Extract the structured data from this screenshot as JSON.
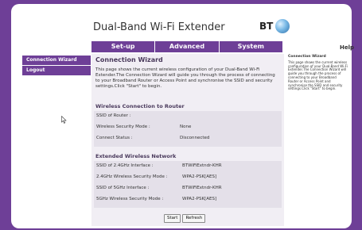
{
  "app_title": "Dual-Band Wi-Fi Extender",
  "logo_text": "BT",
  "nav_tabs": [
    "Set-up",
    "Advanced",
    "System"
  ],
  "help_link": "Help",
  "sidebar_items": [
    "Connection Wizard",
    "Logout"
  ],
  "main": {
    "title": "Connection Wizard",
    "intro": "This page shows the current wireless configuration of your Dual-Band Wi-Fi Extender.The Connection Wizard will guide you through the process of connecting to your Broadband Router or Access Point and synchronise the SSID and security settings.Click \"Start\" to begin."
  },
  "wireless_section": {
    "title": "Wireless Connection to Router",
    "rows": [
      {
        "label": "SSID of Router :",
        "value": ""
      },
      {
        "label": "Wireless Security Mode :",
        "value": "None"
      },
      {
        "label": "Connect Status :",
        "value": "Disconnected"
      }
    ]
  },
  "extended_section": {
    "title": "Extended Wireless Network",
    "rows": [
      {
        "label": "SSID of 2.4GHz Interface :",
        "value": "BTWiFiExtndr-KHR"
      },
      {
        "label": "2.4GHz Wireless Security Mode :",
        "value": "WPA2-PSK[AES]"
      },
      {
        "label": "SSID of 5GHz Interface :",
        "value": "BTWiFiExtndr-KHR"
      },
      {
        "label": "5GHz Wireless Security Mode :",
        "value": "WPA2-PSK[AES]"
      }
    ]
  },
  "buttons": {
    "start": "Start",
    "refresh": "Refresh"
  },
  "help_panel": {
    "title": "Connection Wizard",
    "text": "This page shows the current wireless configuration of your Dual-Band Wi-Fi Extender.The Connection Wizard will guide you through the process of connecting to your Broadband Router or Access Point and synchronise the SSID and security settings.Click \"Start\" to begin."
  },
  "colors": {
    "brand_purple": "#6e3f97",
    "panel_bg": "#f1eef4",
    "section_bg": "#e4e0e9"
  }
}
